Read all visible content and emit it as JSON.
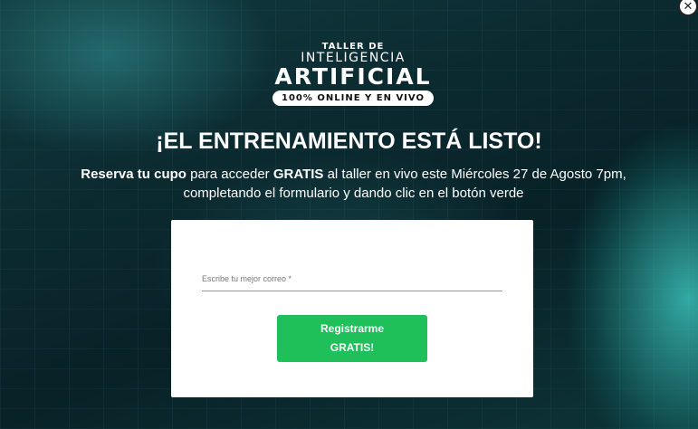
{
  "logo": {
    "line1": "TALLER DE",
    "line2": "INTELIGENCIA",
    "line3": "ARTIFICIAL",
    "badge": "100% ONLINE Y EN VIVO"
  },
  "headline": "¡EL ENTRENAMIENTO ESTÁ LISTO!",
  "subtext": {
    "bold1": "Reserva tu cupo",
    "part1": " para acceder ",
    "bold2": "GRATIS",
    "part2": " al taller en vivo este Miércoles 27 de Agosto 7pm,",
    "line2": "completando el formulario y dando clic en el botón verde"
  },
  "form": {
    "email_placeholder": "Escribe tu mejor correo *",
    "submit_line1": "Registrarme",
    "submit_line2": "GRATIS!"
  },
  "close": {
    "icon": "close-icon",
    "glyph": "✕"
  },
  "colors": {
    "accent": "#1fbf5a",
    "background": "#0b2a30"
  }
}
